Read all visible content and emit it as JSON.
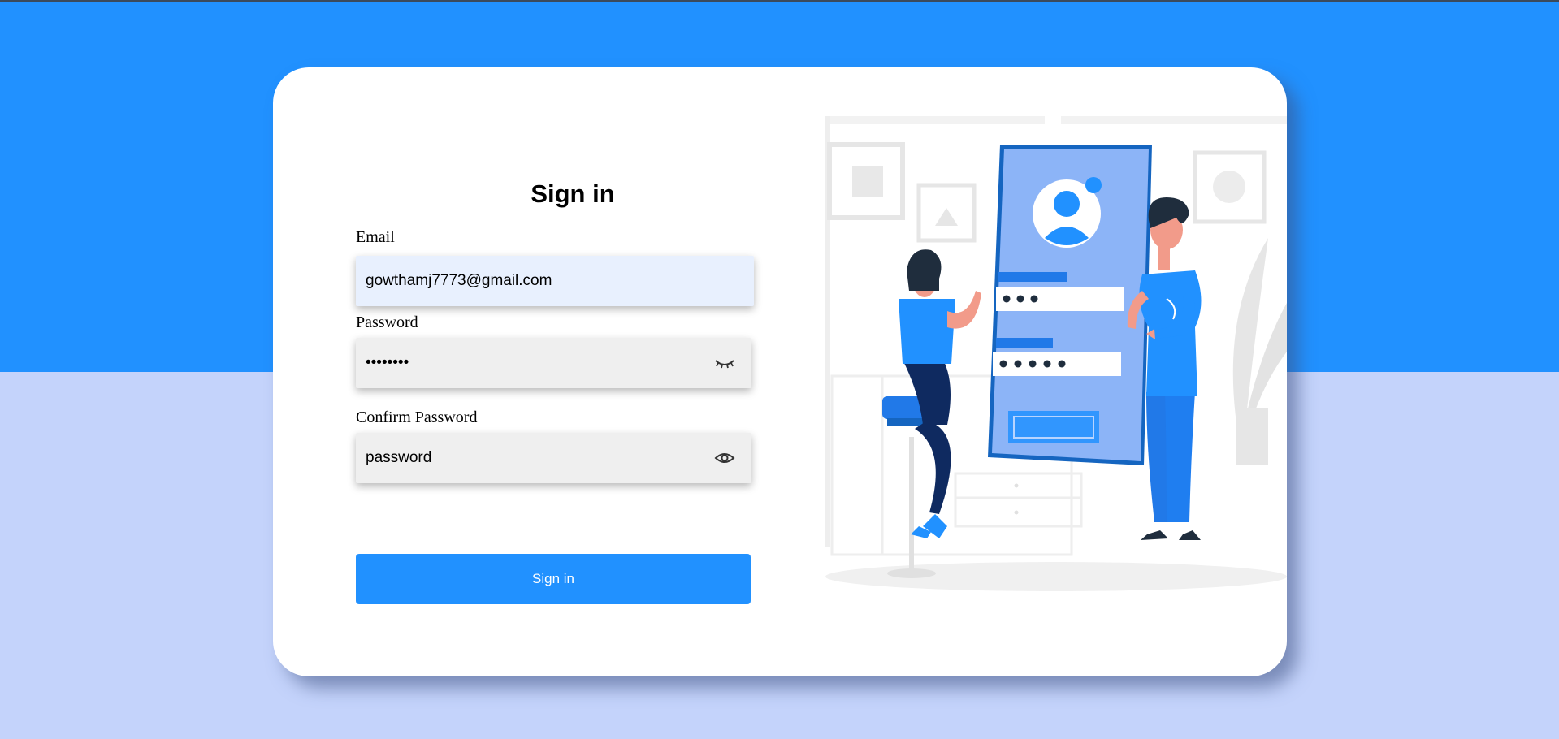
{
  "signin": {
    "title": "Sign in",
    "email_label": "Email",
    "email_value": "gowthamj7773@gmail.com",
    "password_label": "Password",
    "password_value": "password",
    "confirm_label": "Confirm Password",
    "confirm_value": "password",
    "button_label": "Sign in"
  },
  "icons": {
    "password_toggle": "eye-closed-icon",
    "confirm_toggle": "eye-open-icon"
  },
  "colors": {
    "accent": "#2191ff",
    "background_light": "#c4d3fb",
    "card": "#ffffff",
    "field_bg": "#efefef",
    "email_field_bg": "#e8f0fe"
  }
}
